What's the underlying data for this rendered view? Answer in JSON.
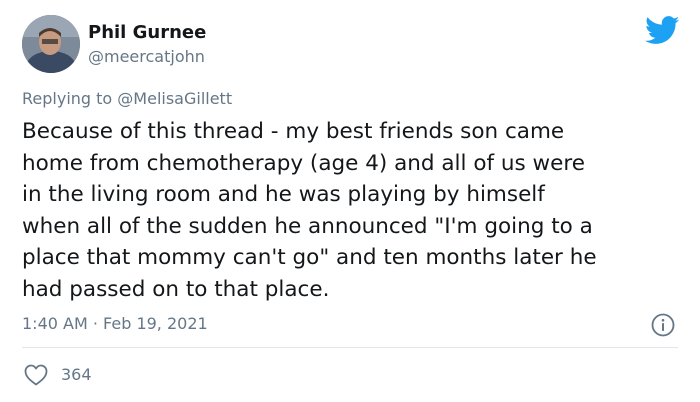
{
  "author": {
    "name": "Phil Gurnee",
    "handle": "@meercatjohn"
  },
  "reply": {
    "prefix": "Replying to",
    "mention": "@MelisaGillett"
  },
  "tweet": {
    "lines": [
      "Because of this thread - my best friends son came",
      "home from chemotherapy (age 4) and all of us were",
      "in the living room and he was playing by himself",
      "when all of the sudden he announced \"I'm going to a",
      "place that mommy can't go\" and ten months later he",
      "had passed on to that place."
    ]
  },
  "meta": {
    "timestamp": "1:40 AM · Feb 19, 2021"
  },
  "engagement": {
    "likes": "364"
  },
  "icons": {
    "logo": "twitter-bird-icon",
    "info": "info-icon",
    "like": "heart-icon"
  },
  "colors": {
    "brand": "#1da1f2",
    "text": "#14171a",
    "muted": "#657786",
    "divider": "#e1e8ed"
  }
}
